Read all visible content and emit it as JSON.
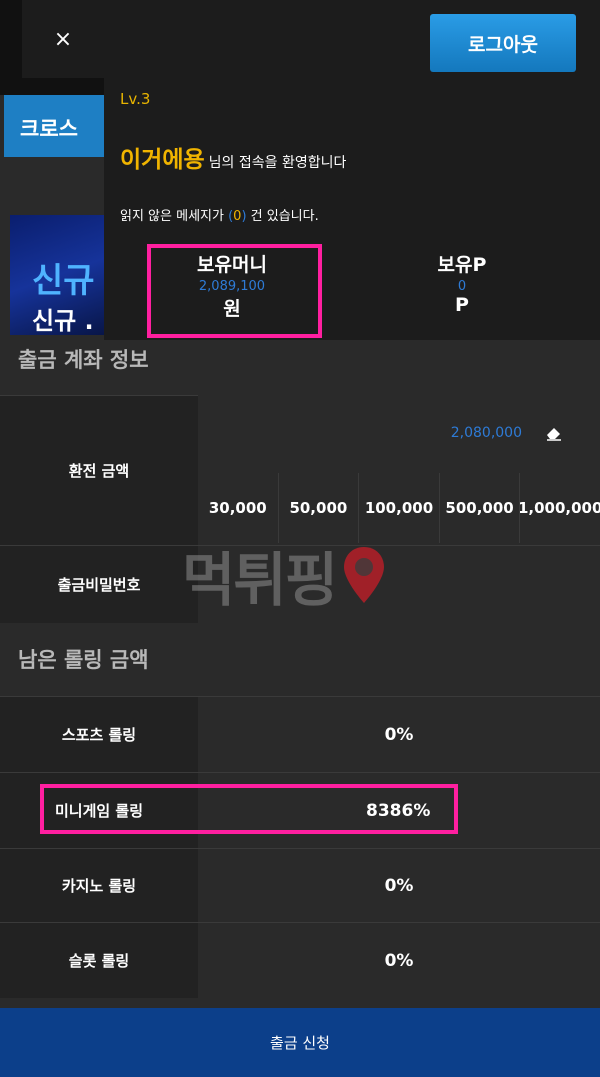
{
  "background": {
    "cross_tab": "크로스",
    "banner_line1": "신규",
    "banner_line2": "신규 ."
  },
  "drawer": {
    "close": "×",
    "logout": "로그아웃",
    "level": "Lv.3",
    "nickname": "이거에용",
    "welcome_suffix": "님의 접속을 환영합니다",
    "unread_prefix": "읽지 않은 메세지가",
    "unread_open": "(",
    "unread_count": "0",
    "unread_close": ")",
    "unread_suffix": "건 있습니다.",
    "money_label": "보유머니",
    "money_value": "2,089,100",
    "money_unit": "원",
    "point_label": "보유P",
    "point_value": "0",
    "point_unit": "P"
  },
  "account_section": {
    "title": "출금 계좌 정보",
    "amount_label": "환전 금액",
    "amount_value": "2,080,000",
    "quick_amounts": [
      "30,000",
      "50,000",
      "100,000",
      "500,000",
      "1,000,000"
    ],
    "password_label": "출금비밀번호"
  },
  "watermark": {
    "text": "먹튀핑"
  },
  "rolling_section": {
    "title": "남은 롤링 금액",
    "rows": [
      {
        "label": "스포츠 롤링",
        "value": "0%"
      },
      {
        "label": "미니게임 롤링",
        "value": "8386%"
      },
      {
        "label": "카지노 롤링",
        "value": "0%"
      },
      {
        "label": "슬롯 롤링",
        "value": "0%"
      }
    ]
  },
  "submit": "출금 신청",
  "colors": {
    "highlight": "#ff1fa0",
    "accent_blue": "#2e7bd6",
    "gold": "#f0b400",
    "submit_bg": "#0c3f8a"
  }
}
